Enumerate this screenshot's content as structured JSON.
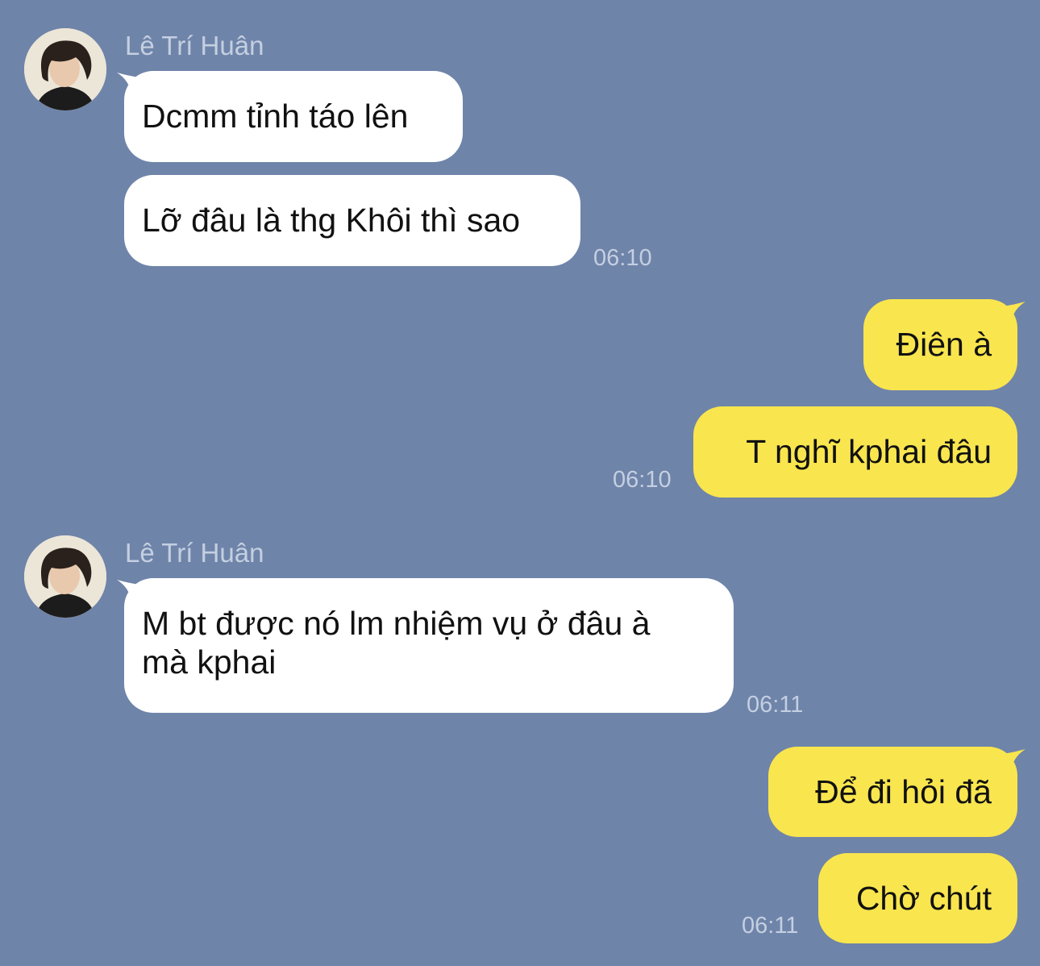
{
  "theme": {
    "background": "#6f84a9",
    "incoming_bubble": "#ffffff",
    "outgoing_bubble": "#f9e54e",
    "meta_text": "#c4cfe1"
  },
  "messages": [
    {
      "sender": "Lê Trí Huân",
      "avatar_icon": "profile-photo",
      "bubbles": [
        "Dcmm tỉnh táo lên",
        "Lỡ đâu là thg Khôi thì sao"
      ],
      "time": "06:10"
    },
    {
      "bubbles": [
        "Điên à",
        "T nghĩ kphai đâu"
      ],
      "time": "06:10"
    },
    {
      "sender": "Lê Trí Huân",
      "avatar_icon": "profile-photo",
      "bubbles": [
        "M bt được nó lm nhiệm vụ ở đâu à\nmà kphai"
      ],
      "time": "06:11"
    },
    {
      "bubbles": [
        "Để đi hỏi đã",
        "Chờ chút"
      ],
      "time": "06:11"
    }
  ]
}
